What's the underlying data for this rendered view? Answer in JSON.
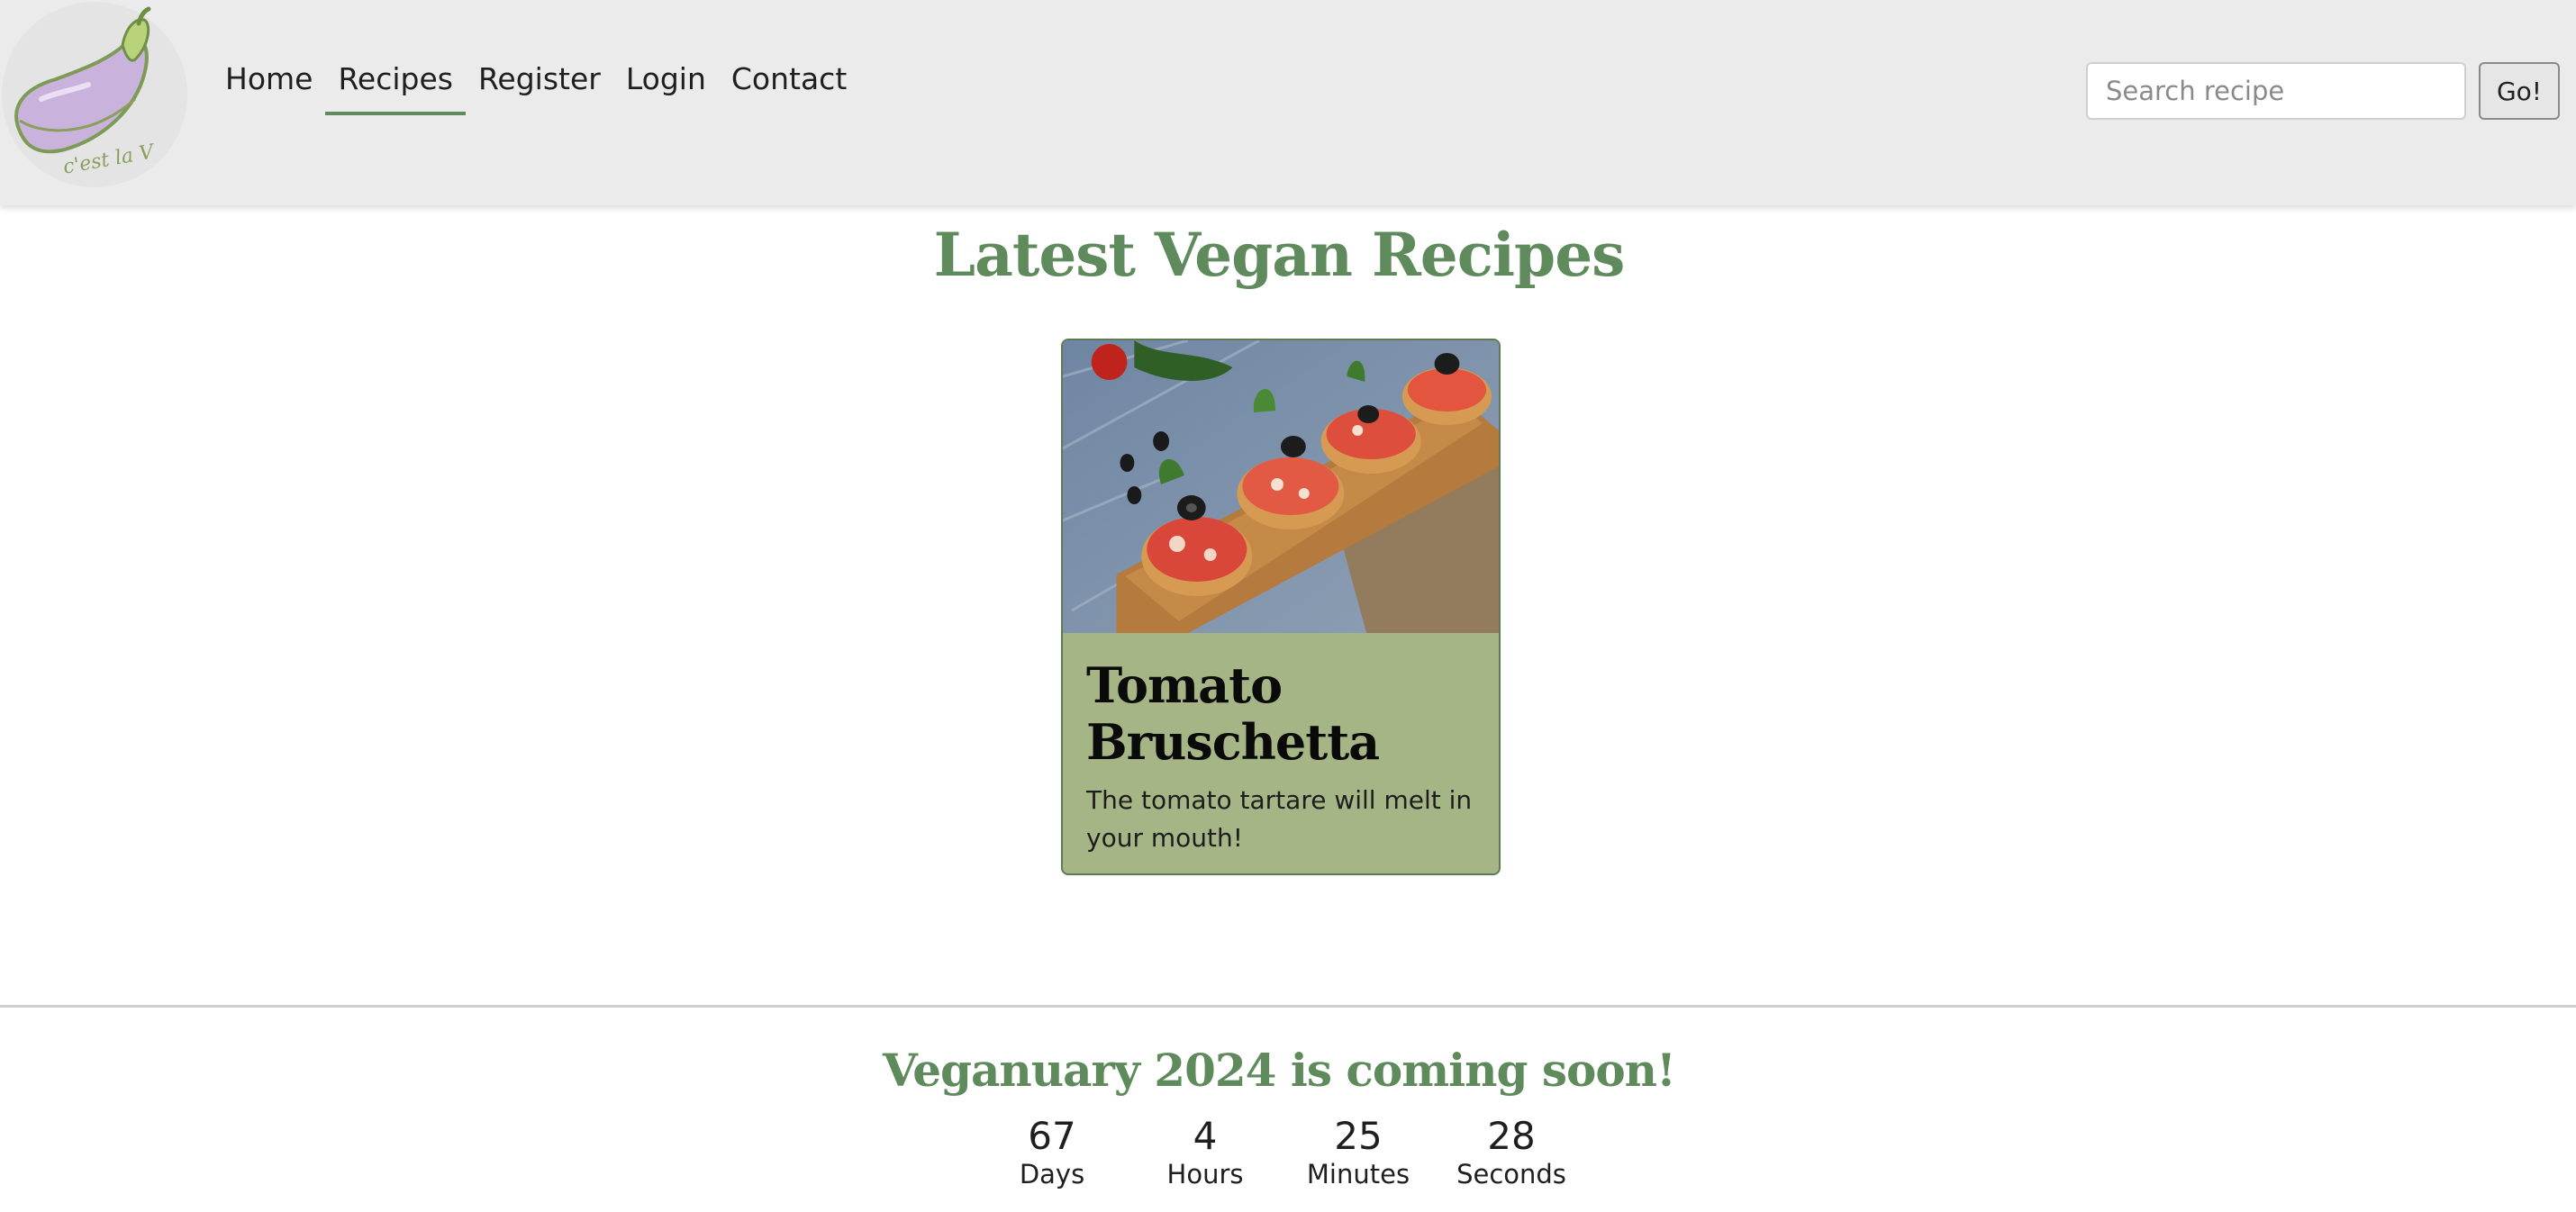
{
  "nav": {
    "logo_text": "c'est la V",
    "links": [
      {
        "label": "Home",
        "active": false
      },
      {
        "label": "Recipes",
        "active": true
      },
      {
        "label": "Register",
        "active": false
      },
      {
        "label": "Login",
        "active": false
      },
      {
        "label": "Contact",
        "active": false
      }
    ],
    "search": {
      "placeholder": "Search recipe",
      "button_label": "Go!"
    }
  },
  "main": {
    "title": "Latest Vegan Recipes",
    "recipes": [
      {
        "title": "Tomato Bruschetta",
        "description": "The tomato tartare will melt in your mouth!"
      }
    ]
  },
  "countdown": {
    "title": "Veganuary 2024 is coming soon!",
    "units": [
      {
        "value": "67",
        "label": "Days"
      },
      {
        "value": "4",
        "label": "Hours"
      },
      {
        "value": "25",
        "label": "Minutes"
      },
      {
        "value": "28",
        "label": "Seconds"
      }
    ]
  },
  "colors": {
    "accent_green": "#5e8a5c",
    "card_green": "#a6b585",
    "navbar_bg": "#ebebeb",
    "logo_eggplant": "#c9b3dc"
  }
}
